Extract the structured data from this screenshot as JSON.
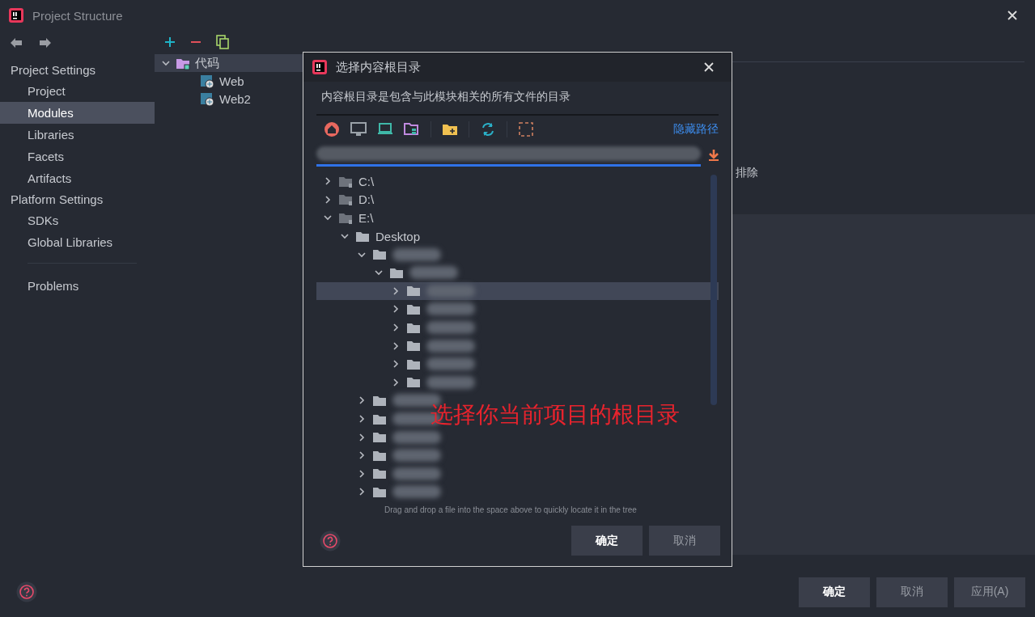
{
  "window": {
    "title": "Project Structure"
  },
  "sidebar": {
    "sections": [
      {
        "heading": "Project Settings",
        "items": [
          {
            "label": "Project",
            "selected": false
          },
          {
            "label": "Modules",
            "selected": true
          },
          {
            "label": "Libraries",
            "selected": false
          },
          {
            "label": "Facets",
            "selected": false
          },
          {
            "label": "Artifacts",
            "selected": false
          }
        ]
      },
      {
        "heading": "Platform Settings",
        "items": [
          {
            "label": "SDKs",
            "selected": false
          },
          {
            "label": "Global Libraries",
            "selected": false
          }
        ]
      },
      {
        "items": [
          {
            "label": "Problems",
            "selected": false
          }
        ]
      }
    ]
  },
  "modules": {
    "tree": [
      {
        "name": "代码",
        "kind": "module",
        "expanded": true,
        "selected": true,
        "children": [
          {
            "name": "Web",
            "kind": "web",
            "selected": false
          },
          {
            "name": "Web2",
            "kind": "web",
            "selected": false
          }
        ]
      }
    ]
  },
  "details": {
    "exclude_label": "排除"
  },
  "footer": {
    "buttons": [
      {
        "label": "确定",
        "kind": "primary"
      },
      {
        "label": "取消",
        "kind": "secondary"
      },
      {
        "label": "应用(A)",
        "kind": "secondary"
      }
    ]
  },
  "dialog": {
    "title": "选择内容根目录",
    "description": "内容根目录是包含与此模块相关的所有文件的目录",
    "hide_path_link": "隐藏路径",
    "tree": [
      {
        "name": "C:\\",
        "kind": "drive",
        "expanded": false,
        "selected": false
      },
      {
        "name": "D:\\",
        "kind": "drive",
        "expanded": false,
        "selected": false
      },
      {
        "name": "E:\\",
        "kind": "drive",
        "expanded": true,
        "selected": false,
        "children": [
          {
            "name": "Desktop",
            "kind": "folder",
            "expanded": true,
            "selected": false,
            "children": [
              {
                "kind": "folder",
                "expanded": true,
                "selected": false,
                "children": [
                  {
                    "kind": "folder",
                    "expanded": true,
                    "selected": false,
                    "children": [
                      {
                        "kind": "folder",
                        "expanded": false,
                        "selected": true
                      },
                      {
                        "kind": "folder",
                        "expanded": false,
                        "selected": false
                      },
                      {
                        "kind": "folder",
                        "expanded": false,
                        "selected": false
                      },
                      {
                        "kind": "folder",
                        "expanded": false,
                        "selected": false
                      },
                      {
                        "kind": "folder",
                        "expanded": false,
                        "selected": false
                      },
                      {
                        "kind": "folder",
                        "expanded": false,
                        "selected": false
                      }
                    ]
                  }
                ]
              },
              {
                "kind": "folder",
                "expanded": false,
                "selected": false
              },
              {
                "kind": "folder",
                "expanded": false,
                "selected": false
              },
              {
                "kind": "folder",
                "expanded": false,
                "selected": false
              },
              {
                "kind": "folder",
                "expanded": false,
                "selected": false
              },
              {
                "kind": "folder",
                "expanded": false,
                "selected": false
              },
              {
                "kind": "folder",
                "expanded": false,
                "selected": false
              }
            ]
          }
        ]
      }
    ],
    "hint": "Drag and drop a file into the space above to quickly locate it in the tree",
    "annotation": "选择你当前项目的根目录",
    "buttons": [
      {
        "label": "确定",
        "kind": "primary"
      },
      {
        "label": "取消",
        "kind": "secondary"
      }
    ]
  }
}
